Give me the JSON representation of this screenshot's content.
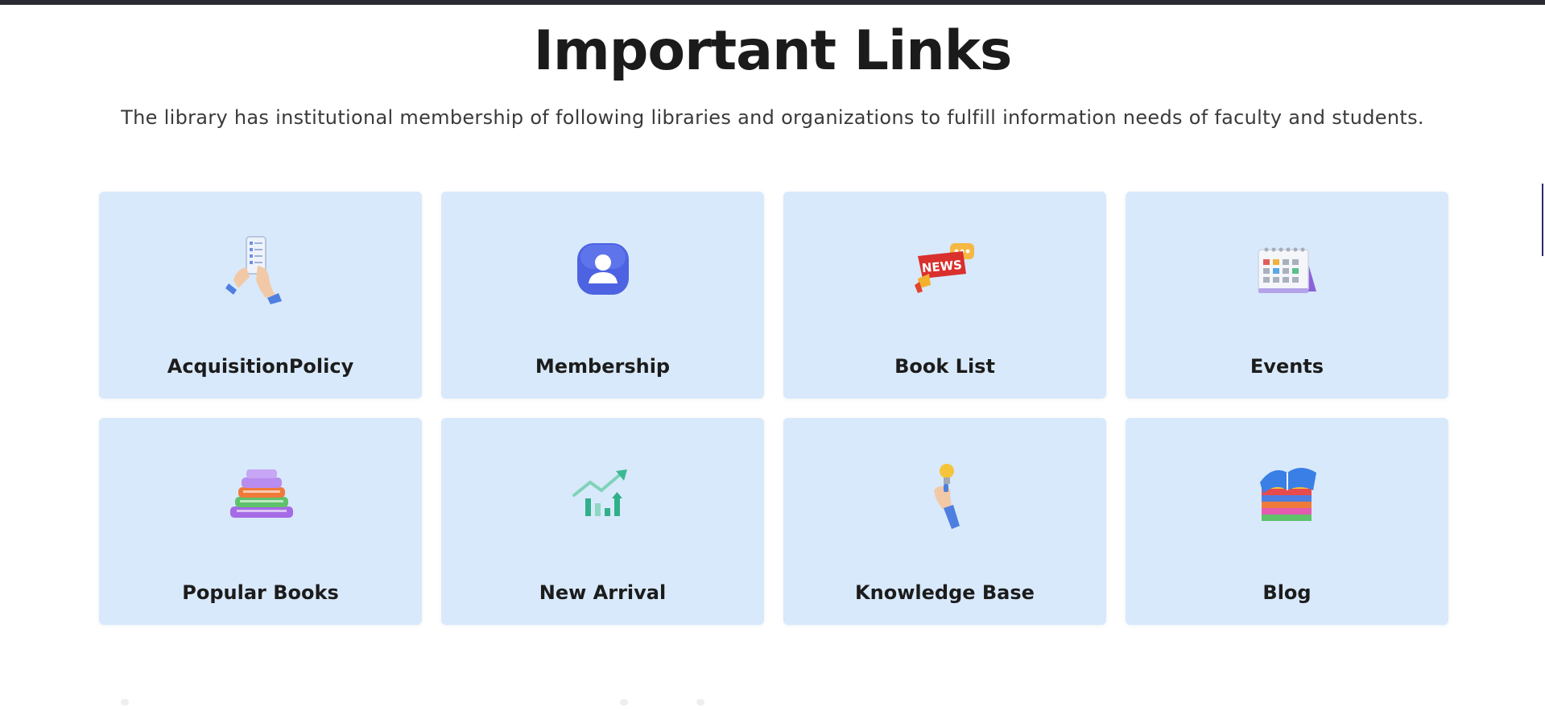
{
  "header": {
    "title": "Important Links",
    "subtitle": "The library has institutional membership of following libraries and organizations to fulfill information needs of faculty and students."
  },
  "cards": [
    {
      "label": "AcquisitionPolicy",
      "icon": "phone-checklist-hand-icon"
    },
    {
      "label": "Membership",
      "icon": "user-profile-icon"
    },
    {
      "label": "Book List",
      "icon": "news-megaphone-icon"
    },
    {
      "label": "Events",
      "icon": "calendar-icon"
    },
    {
      "label": "Popular Books",
      "icon": "book-stack-icon"
    },
    {
      "label": "New Arrival",
      "icon": "growth-chart-icon"
    },
    {
      "label": "Knowledge Base",
      "icon": "lightbulb-hand-icon"
    },
    {
      "label": "Blog",
      "icon": "open-book-icon"
    }
  ],
  "colors": {
    "card_background": "#d8e9fb",
    "top_bar": "#2a2a33",
    "title_text": "#1b1b1b"
  }
}
